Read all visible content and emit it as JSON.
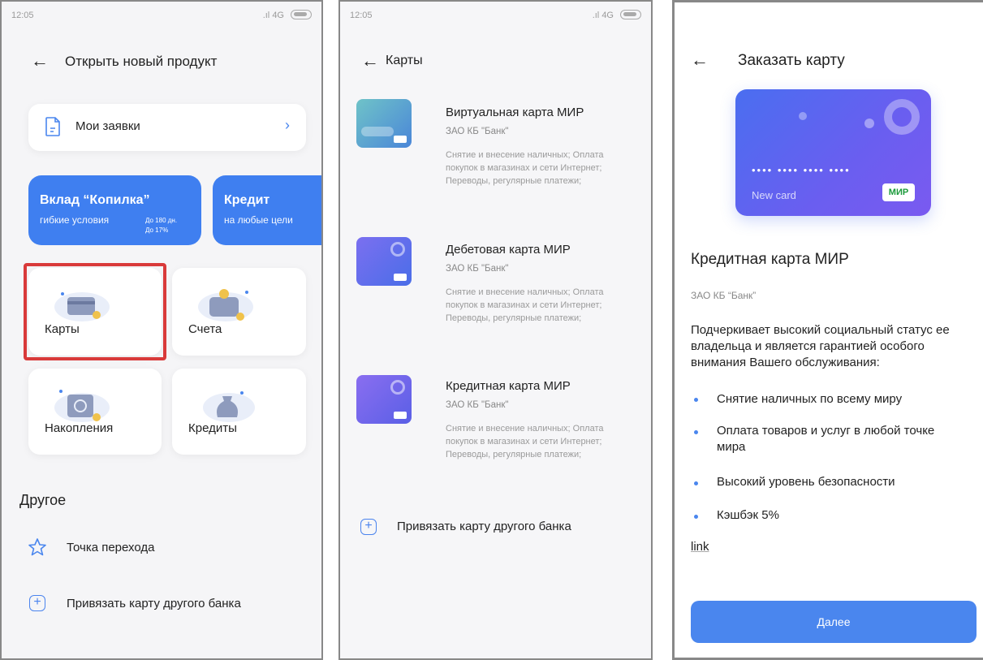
{
  "status": {
    "time": "12:05",
    "network": "4G"
  },
  "screen1": {
    "title": "Открыть новый продукт",
    "my_requests": "Мои заявки",
    "promo1": {
      "title": "Вклад “Копилка”",
      "desc": "гибкие условия",
      "note1": "До 180 дн.",
      "note2": "До 17%"
    },
    "promo2": {
      "title": "Кредит",
      "desc": "на любые цели"
    },
    "tiles": [
      "Карты",
      "Счета",
      "Накопления",
      "Кредиты"
    ],
    "other_title": "Другое",
    "other_items": [
      "Точка перехода",
      "Привязать карту другого банка"
    ]
  },
  "screen2": {
    "title": "Карты",
    "cards": [
      {
        "title": "Виртуальная карта МИР",
        "bank": "ЗАО КБ \"Банк\"",
        "desc": "Снятие и внесение наличных; Оплата покупок в магазинах и сети Интернет; Переводы, регулярные платежи;"
      },
      {
        "title": "Дебетовая карта МИР",
        "bank": "ЗАО КБ \"Банк\"",
        "desc": "Снятие и внесение наличных; Оплата покупок в магазинах и сети Интернет; Переводы, регулярные платежи;"
      },
      {
        "title": "Кредитная карта МИР",
        "bank": "ЗАО КБ \"Банк\"",
        "desc": "Снятие и внесение наличных; Оплата покупок в магазинах и сети Интернет; Переводы, регулярные платежи;"
      }
    ],
    "link_other": "Привязать карту другого банка"
  },
  "screen3": {
    "title": "Заказать карту",
    "card_label": "New card",
    "card_dots": "•••• •••• •••• ••••",
    "card_brand": "МИР",
    "product_title": "Кредитная карта МИР",
    "bank": "ЗАО КБ “Банк”",
    "description": "Подчеркивает высокий социальный статус ее владельца и является гарантией особого внимания Вашего обслуживания:",
    "bullets": [
      "Снятие наличных по всему миру",
      "Оплата товаров и услуг в любой точке мира",
      "Высокий уровень безопасности",
      "Кэшбэк 5%"
    ],
    "link": "link",
    "next_button": "Далее"
  },
  "colors": {
    "accent": "#4a86ee",
    "highlight": "#d93a3a",
    "promo": "#3f7ff0"
  },
  "icons": [
    "back-arrow-icon",
    "document-icon",
    "chevron-right-icon",
    "star-icon",
    "plus-icon",
    "mir-logo-icon"
  ]
}
